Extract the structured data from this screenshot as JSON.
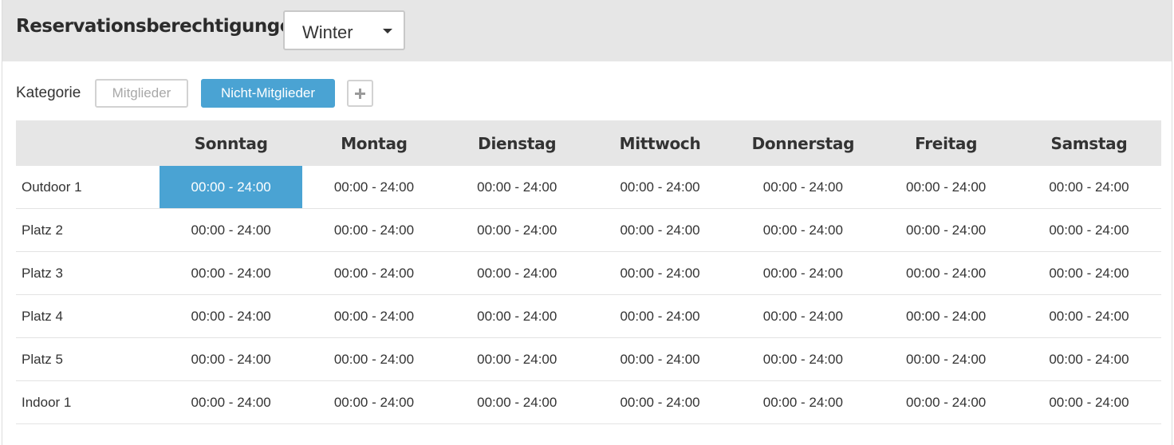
{
  "header": {
    "title": "Reservationsberechtigungen",
    "season_select": {
      "value": "Winter"
    }
  },
  "category": {
    "label": "Kategorie",
    "buttons": [
      {
        "label": "Mitglieder",
        "active": false
      },
      {
        "label": "Nicht-Mitglieder",
        "active": true
      }
    ],
    "add_icon": "plus-icon"
  },
  "colors": {
    "accent": "#4aa3d3",
    "header_bg": "#e6e6e6"
  },
  "table": {
    "columns": [
      "",
      "Sonntag",
      "Montag",
      "Dienstag",
      "Mittwoch",
      "Donnerstag",
      "Freitag",
      "Samstag"
    ],
    "rows": [
      {
        "name": "Outdoor 1",
        "cells": [
          "00:00 - 24:00",
          "00:00 - 24:00",
          "00:00 - 24:00",
          "00:00 - 24:00",
          "00:00 - 24:00",
          "00:00 - 24:00",
          "00:00 - 24:00"
        ],
        "selected_index": 0
      },
      {
        "name": "Platz 2",
        "cells": [
          "00:00 - 24:00",
          "00:00 - 24:00",
          "00:00 - 24:00",
          "00:00 - 24:00",
          "00:00 - 24:00",
          "00:00 - 24:00",
          "00:00 - 24:00"
        ]
      },
      {
        "name": "Platz 3",
        "cells": [
          "00:00 - 24:00",
          "00:00 - 24:00",
          "00:00 - 24:00",
          "00:00 - 24:00",
          "00:00 - 24:00",
          "00:00 - 24:00",
          "00:00 - 24:00"
        ]
      },
      {
        "name": "Platz 4",
        "cells": [
          "00:00 - 24:00",
          "00:00 - 24:00",
          "00:00 - 24:00",
          "00:00 - 24:00",
          "00:00 - 24:00",
          "00:00 - 24:00",
          "00:00 - 24:00"
        ]
      },
      {
        "name": "Platz 5",
        "cells": [
          "00:00 - 24:00",
          "00:00 - 24:00",
          "00:00 - 24:00",
          "00:00 - 24:00",
          "00:00 - 24:00",
          "00:00 - 24:00",
          "00:00 - 24:00"
        ]
      },
      {
        "name": "Indoor 1",
        "cells": [
          "00:00 - 24:00",
          "00:00 - 24:00",
          "00:00 - 24:00",
          "00:00 - 24:00",
          "00:00 - 24:00",
          "00:00 - 24:00",
          "00:00 - 24:00"
        ]
      }
    ]
  }
}
